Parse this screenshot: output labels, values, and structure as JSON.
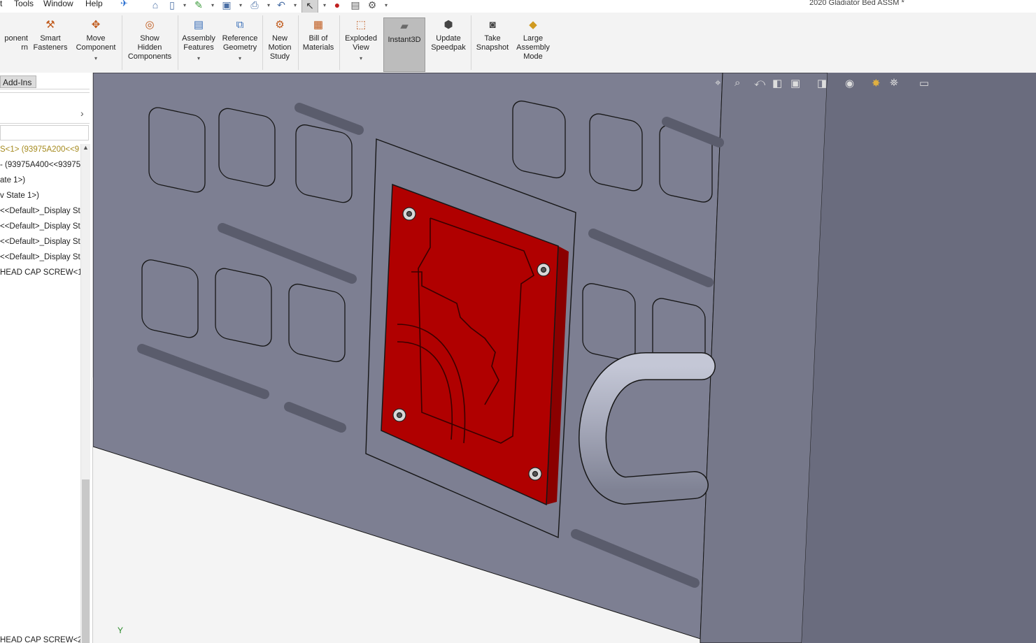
{
  "menu": {
    "items": [
      "t",
      "Tools",
      "Window",
      "Help"
    ]
  },
  "title_bar": {
    "document_title": "2020 Gladiator Bed ASSM *"
  },
  "quick_access": {
    "icons": [
      "pin-icon",
      "home-icon",
      "new-document-icon",
      "open-icon",
      "save-icon",
      "print-icon",
      "undo-icon",
      "select-pointer-icon",
      "rebuild-traffic-light-icon",
      "file-properties-icon",
      "options-gear-icon"
    ]
  },
  "ribbon": {
    "tools": [
      {
        "id": "component-pattern",
        "label": "ponent\nrn",
        "icon": "component-pattern-icon"
      },
      {
        "id": "smart-fasteners",
        "label": "Smart\nFasteners",
        "icon": "smart-fasteners-icon"
      },
      {
        "id": "move-component",
        "label": "Move\nComponent",
        "icon": "move-component-icon",
        "dropdown": true
      },
      {
        "id": "show-hidden-components",
        "label": "Show\nHidden\nComponents",
        "icon": "show-hidden-icon"
      },
      {
        "id": "assembly-features",
        "label": "Assembly\nFeatures",
        "icon": "assembly-features-icon",
        "dropdown": true
      },
      {
        "id": "reference-geometry",
        "label": "Reference\nGeometry",
        "icon": "reference-geometry-icon",
        "dropdown": true
      },
      {
        "id": "new-motion-study",
        "label": "New\nMotion\nStudy",
        "icon": "motion-study-icon"
      },
      {
        "id": "bill-of-materials",
        "label": "Bill of\nMaterials",
        "icon": "bill-of-materials-icon"
      },
      {
        "id": "exploded-view",
        "label": "Exploded\nView",
        "icon": "exploded-view-icon",
        "dropdown": true
      },
      {
        "id": "instant3d",
        "label": "Instant3D",
        "icon": "instant3d-icon",
        "active": true
      },
      {
        "id": "update-speedpak",
        "label": "Update\nSpeedpak",
        "icon": "speedpak-icon"
      },
      {
        "id": "take-snapshot",
        "label": "Take\nSnapshot",
        "icon": "camera-icon"
      },
      {
        "id": "large-assembly-mode",
        "label": "Large\nAssembly\nMode",
        "icon": "large-assembly-icon"
      }
    ],
    "dropdown_glyph": "▾"
  },
  "panel": {
    "tab_label": "Add-Ins",
    "chevron": "›",
    "tree_items": [
      {
        "text": "S<1> (93975A200<<9",
        "highlight": true
      },
      {
        "text": "- (93975A400<<93975",
        "highlight": false
      },
      {
        "text": "ate 1>)",
        "highlight": false
      },
      {
        "text": "v State 1>)",
        "highlight": false
      },
      {
        "text": "<<Default>_Display St",
        "highlight": false
      },
      {
        "text": "<<Default>_Display St",
        "highlight": false
      },
      {
        "text": "<<Default>_Display St",
        "highlight": false
      },
      {
        "text": "<<Default>_Display St",
        "highlight": false
      },
      {
        "text": " HEAD CAP SCREW<1",
        "highlight": false
      }
    ],
    "bottom_item": "HEAD CAP SCREW<2",
    "scroll_up_glyph": "▲",
    "splitter_glyph": "‹"
  },
  "heads_up_toolbar": {
    "icons": [
      "zoom-to-fit-icon",
      "zoom-to-area-icon",
      "previous-view-icon",
      "section-view-icon",
      "view-orientation-icon",
      "display-style-icon",
      "hide-show-items-icon",
      "edit-appearance-icon",
      "apply-scene-icon",
      "view-settings-icon"
    ]
  },
  "viewport": {
    "colors": {
      "panel_gray": "#7d7f92",
      "panel_right": "#6a6c7e",
      "side_face": "#76788a",
      "plate_red": "#b00000",
      "plate_dark": "#8a0000",
      "hook": "#a2a5b6",
      "floor": "#f4f4f4",
      "edge": "#161616"
    },
    "triad_glyph": "Y"
  }
}
